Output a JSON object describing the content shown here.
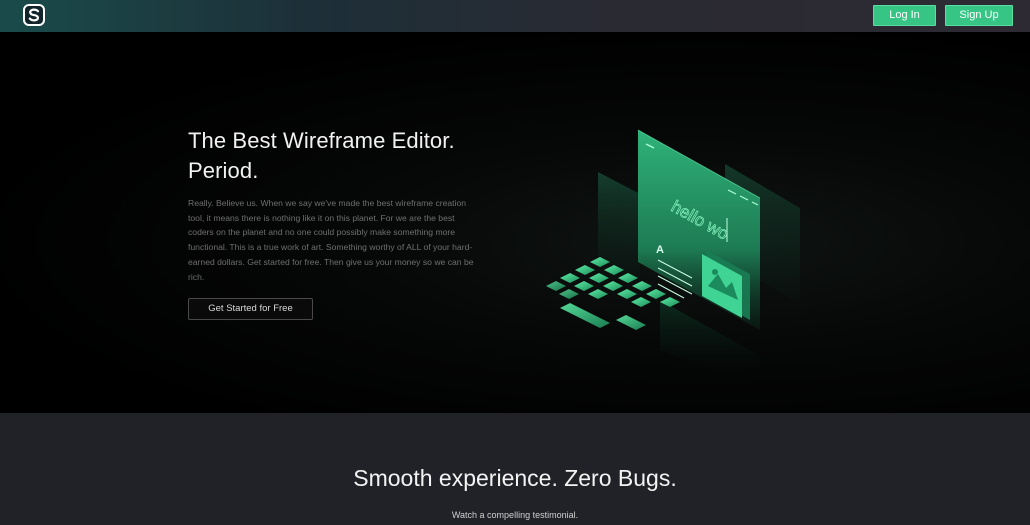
{
  "header": {
    "logo_icon": "s-logo-icon",
    "login_label": "Log In",
    "signup_label": "Sign Up"
  },
  "hero": {
    "title_line1": "The Best Wireframe Editor.",
    "title_line2": "Period.",
    "body": "Really. Believe us. When we say we've made the best wireframe creation tool, it means there is nothing like it on this planet. For we are the best coders on the planet and no one could possibly make something more functional. This is a true work of art. Something worthy of ALL of your hard-earned dollars. Get started for free. Then give us your money so we can be rich.",
    "cta_label": "Get Started for Free",
    "illustration_text": "hello wo",
    "illustration_letter": "A"
  },
  "section": {
    "title": "Smooth experience. Zero Bugs.",
    "subtitle": "Watch a compelling testimonial."
  },
  "colors": {
    "accent": "#36c585",
    "hero_bg": "#000000",
    "section_bg": "#212227"
  }
}
